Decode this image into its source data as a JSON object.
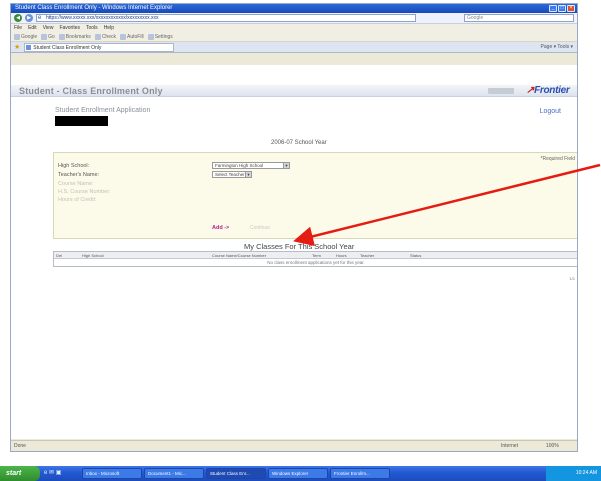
{
  "window": {
    "title": "Student Class Enrollment Only - Windows Internet Explorer",
    "address": "https://www.xxxxx.xxx/xxxxxxxxxxxx/xxxxxxxxx.xxx",
    "search_placeholder": "Google"
  },
  "menubar": [
    "File",
    "Edit",
    "View",
    "Favorites",
    "Tools",
    "Help"
  ],
  "toolbar": [
    "Google",
    "Go",
    "Bookmarks",
    "Check",
    "AutoFill",
    "Settings"
  ],
  "tab": {
    "label": "Student Class Enrollment Only"
  },
  "tabtools": "Page ▾  Tools ▾",
  "page": {
    "header_title": "Student - Class Enrollment Only",
    "logo_main": "Frontier",
    "app_title": "Student Enrollment Application",
    "logout": "Logout",
    "year_title": "2006-07 School Year",
    "required_note": "*Required Field",
    "fields": [
      {
        "label": "High School:",
        "value": "Farmington High School",
        "active": true
      },
      {
        "label": "Teacher's Name:",
        "value": "Select Teacher",
        "active": true
      },
      {
        "label": "Course Name:",
        "value": "",
        "active": false
      },
      {
        "label": "H.S. Course Number:",
        "value": "",
        "active": false
      },
      {
        "label": "Hours of Credit:",
        "value": "",
        "active": false
      }
    ],
    "add_label": "Add ->",
    "continue_label": "Continue",
    "classes_title": "My Classes For This School Year",
    "table_headers": [
      "Del",
      "High School",
      "Course Name/Course Number",
      "Term",
      "Hours",
      "Teacher",
      "Status"
    ],
    "empty_message": "No class enrollment applications yet for this year.",
    "page_count": "1/1"
  },
  "statusbar": {
    "left": "Done",
    "zone": "Internet",
    "zoom": "100%"
  },
  "taskbar": {
    "start": "start",
    "tasks": [
      "Inbox - Microsoft",
      "Document1 - Mic...",
      "Student Class Enr...",
      "Windows Explorer",
      "Frontier Enrollm..."
    ],
    "clock": "10:24 AM"
  },
  "colors": {
    "annotation_arrow": "#e51c12",
    "logo_blue": "#2a50b0",
    "add_button": "#b0228a"
  }
}
